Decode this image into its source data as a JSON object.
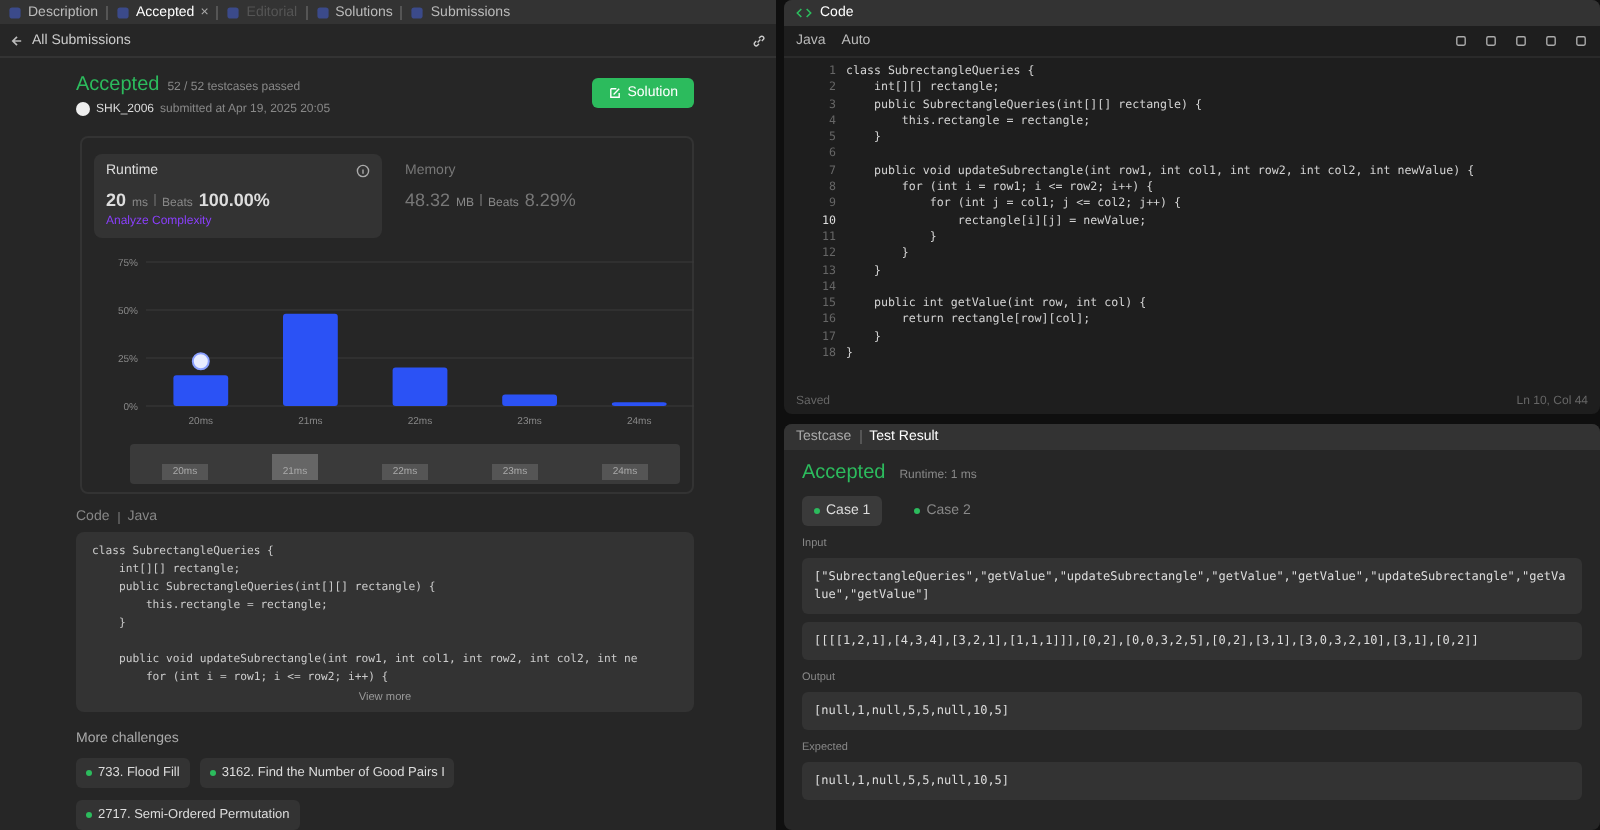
{
  "left_tabs": [
    {
      "label": "Description",
      "selected": false,
      "disabled": false,
      "closable": false
    },
    {
      "label": "Accepted",
      "selected": true,
      "disabled": false,
      "closable": true
    },
    {
      "label": "Editorial",
      "selected": false,
      "disabled": true,
      "closable": false
    },
    {
      "label": "Solutions",
      "selected": false,
      "disabled": false,
      "closable": false
    },
    {
      "label": "Submissions",
      "selected": false,
      "disabled": false,
      "closable": false
    }
  ],
  "close_glyph": "×",
  "back_link": "All Submissions",
  "submission": {
    "status": "Accepted",
    "passed": "52 / 52 testcases passed",
    "user": "SHK_2006",
    "submitted": "submitted at Apr 19, 2025 20:05",
    "solution_button": "Solution"
  },
  "stats": [
    {
      "title": "Runtime",
      "selected": true,
      "value": "20",
      "unit": "ms",
      "beats_label": "Beats",
      "beats": "100.00%",
      "link": "Analyze Complexity"
    },
    {
      "title": "Memory",
      "selected": false,
      "value": "48.32",
      "unit": "MB",
      "beats_label": "Beats",
      "beats": "8.29%"
    }
  ],
  "chart_data": {
    "type": "bar",
    "categories": [
      "20ms",
      "21ms",
      "22ms",
      "23ms",
      "24ms"
    ],
    "values": [
      16,
      48,
      20,
      6,
      2
    ],
    "ylim": [
      0,
      75
    ],
    "yticks": [
      {
        "value": 0,
        "label": "0%"
      },
      {
        "value": 25,
        "label": "25%"
      },
      {
        "value": 50,
        "label": "50%"
      },
      {
        "value": 75,
        "label": "75%"
      }
    ]
  },
  "range_labels": [
    {
      "label": "20ms",
      "selected": false
    },
    {
      "label": "21ms",
      "selected": true
    },
    {
      "label": "22ms",
      "selected": false
    },
    {
      "label": "23ms",
      "selected": false
    },
    {
      "label": "24ms",
      "selected": false
    }
  ],
  "code_meta": {
    "label": "Code",
    "language": "Java"
  },
  "snippet": [
    {
      "kind": "code",
      "text": "class SubrectangleQueries {"
    },
    {
      "kind": "code",
      "text": "    int[][] rectangle;"
    },
    {
      "kind": "code",
      "text": "    public SubrectangleQueries(int[][] rectangle) {"
    },
    {
      "kind": "code",
      "text": "        this.rectangle = rectangle;"
    },
    {
      "kind": "code",
      "text": "    }"
    },
    {
      "kind": "blank"
    },
    {
      "kind": "code",
      "text": "    public void updateSubrectangle(int row1, int col1, int row2, int col2, int ne"
    },
    {
      "kind": "code",
      "text": "        for (int i = row1; i <= row2; i++) {"
    }
  ],
  "view_more": "View more",
  "more_challenges": {
    "title": "More challenges",
    "items": [
      "733. Flood Fill",
      "3162. Find the Number of Good Pairs I",
      "2717. Semi-Ordered Permutation"
    ]
  },
  "editor": {
    "title": "Code",
    "language": "Java",
    "mode": "Auto",
    "lines": [
      {
        "n": "1",
        "text": "class SubrectangleQueries {"
      },
      {
        "n": "2",
        "text": "    int[][] rectangle;"
      },
      {
        "n": "3",
        "text": "    public SubrectangleQueries(int[][] rectangle) {"
      },
      {
        "n": "4",
        "text": "        this.rectangle = rectangle;"
      },
      {
        "n": "5",
        "text": "    }"
      },
      {
        "n": "6"
      },
      {
        "n": "7",
        "text": "    public void updateSubrectangle(int row1, int col1, int row2, int col2, int newValue) {"
      },
      {
        "n": "8",
        "text": "        for (int i = row1; i <= row2; i++) {"
      },
      {
        "n": "9",
        "text": "            for (int j = col1; j <= col2; j++) {"
      },
      {
        "n": "10",
        "current": true,
        "text": "                rectangle[i][j] = newValue;"
      },
      {
        "n": "11",
        "text": "            }"
      },
      {
        "n": "12",
        "text": "        }"
      },
      {
        "n": "13",
        "text": "    }"
      },
      {
        "n": "14"
      },
      {
        "n": "15",
        "text": "    public int getValue(int row, int col) {"
      },
      {
        "n": "16",
        "text": "        return rectangle[row][col];"
      },
      {
        "n": "17",
        "text": "    }"
      },
      {
        "n": "18",
        "text": "}"
      }
    ],
    "saved": "Saved",
    "cursor": "Ln 10, Col 44"
  },
  "result_tabs": [
    {
      "label": "Testcase",
      "selected": false
    },
    {
      "label": "Test Result",
      "selected": true
    }
  ],
  "result": {
    "status": "Accepted",
    "runtime": "Runtime: 1 ms",
    "cases": [
      {
        "label": "Case 1",
        "selected": true
      },
      {
        "label": "Case 2",
        "selected": false
      }
    ],
    "sections": [
      {
        "label": "Input",
        "values": [
          "[\"SubrectangleQueries\",\"getValue\",\"updateSubrectangle\",\"getValue\",\"getValue\",\"updateSubrectangle\",\"getValue\",\"getValue\"]",
          "[[[[1,2,1],[4,3,4],[3,2,1],[1,1,1]]],[0,2],[0,0,3,2,5],[0,2],[3,1],[3,0,3,2,10],[3,1],[0,2]]"
        ]
      },
      {
        "label": "Output",
        "values": [
          "[null,1,null,5,5,null,10,5]"
        ]
      },
      {
        "label": "Expected",
        "values": [
          "[null,1,null,5,5,null,10,5]"
        ]
      }
    ]
  }
}
